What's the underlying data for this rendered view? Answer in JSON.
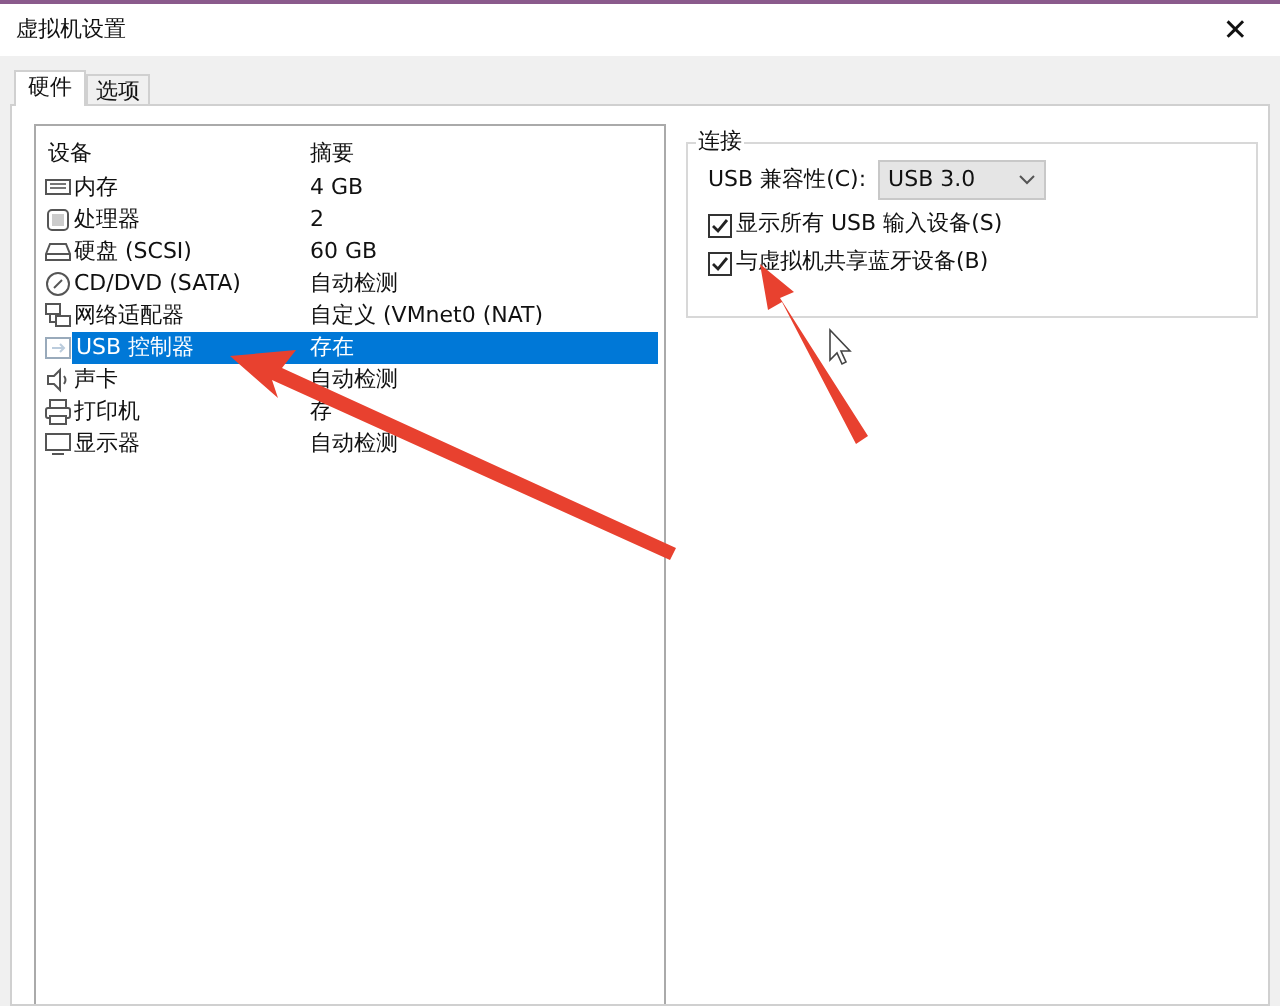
{
  "window": {
    "title": "虚拟机设置",
    "close": "✕"
  },
  "tabs": [
    {
      "label": "硬件",
      "selected": true
    },
    {
      "label": "选项",
      "selected": false
    }
  ],
  "devices": {
    "columns": [
      "设备",
      "摘要"
    ],
    "rows": [
      {
        "kind": "memory",
        "name": "内存",
        "summary": "4 GB",
        "selected": false
      },
      {
        "kind": "cpu",
        "name": "处理器",
        "summary": "2",
        "selected": false
      },
      {
        "kind": "disk",
        "name": "硬盘 (SCSI)",
        "summary": "60 GB",
        "selected": false
      },
      {
        "kind": "cd",
        "name": "CD/DVD (SATA)",
        "summary": "自动检测",
        "selected": false
      },
      {
        "kind": "network",
        "name": "网络适配器",
        "summary": "自定义 (VMnet0 (NAT)",
        "selected": false
      },
      {
        "kind": "usb",
        "name": "USB 控制器",
        "summary": "存在",
        "selected": true
      },
      {
        "kind": "sound",
        "name": "声卡",
        "summary": "自动检测",
        "selected": false
      },
      {
        "kind": "printer",
        "name": "打印机",
        "summary": "存",
        "selected": false
      },
      {
        "kind": "display",
        "name": "显示器",
        "summary": "自动检测",
        "selected": false
      }
    ]
  },
  "connection": {
    "title": "连接",
    "compat_label": "USB 兼容性(C):",
    "compat_value": "USB 3.0",
    "options": [
      {
        "label": "显示所有 USB 输入设备(S)",
        "checked": true
      },
      {
        "label": "与虚拟机共享蓝牙设备(B)",
        "checked": true
      }
    ]
  }
}
